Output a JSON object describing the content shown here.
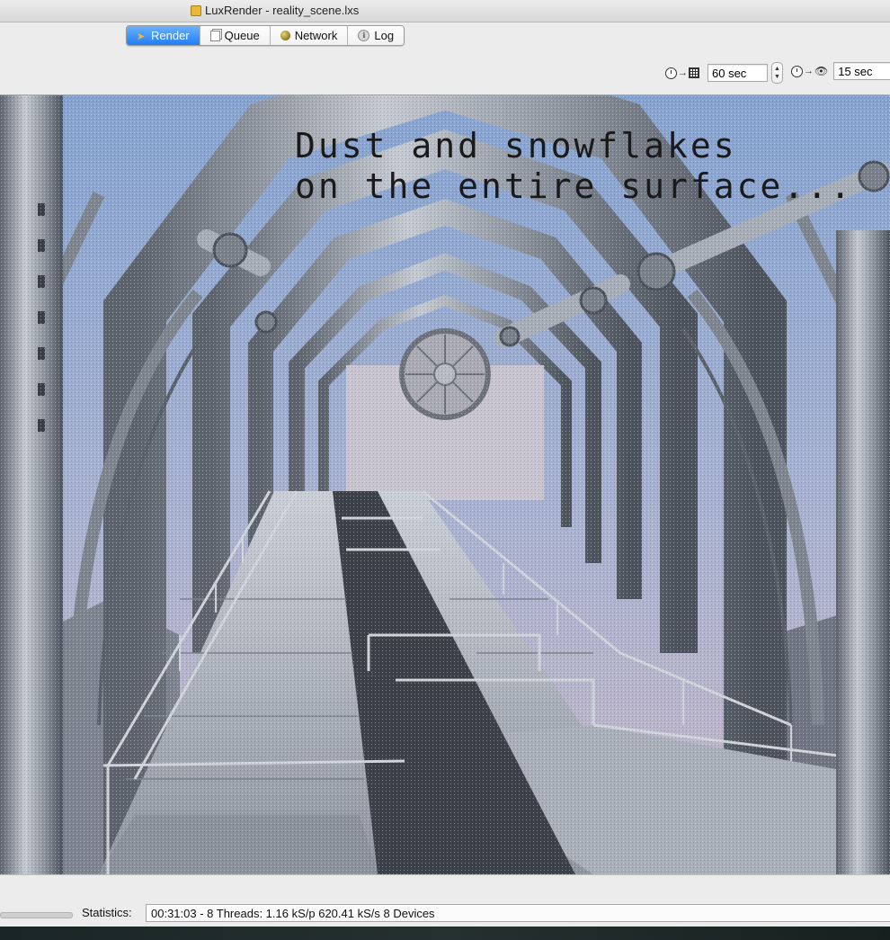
{
  "window": {
    "title": "LuxRender - reality_scene.lxs"
  },
  "tabs": [
    {
      "label": "Render",
      "icon": "render-arrow-icon",
      "active": true
    },
    {
      "label": "Queue",
      "icon": "queue-icon",
      "active": false
    },
    {
      "label": "Network",
      "icon": "network-globe-icon",
      "active": false
    },
    {
      "label": "Log",
      "icon": "log-info-icon",
      "active": false
    }
  ],
  "timers": {
    "halt_time_value": "60 sec",
    "refresh_time_value": "15 sec"
  },
  "render": {
    "overlay_line1": "Dust and snowflakes",
    "overlay_line2": "on the entire surface..."
  },
  "status": {
    "statistics_label": "Statistics:",
    "statistics_value": "00:31:03 - 8 Threads: 1.16 kS/p 620.41 kS/s 8 Devices"
  },
  "colors": {
    "active_tab": "#1f7ef6",
    "sky": "#8ea6c9",
    "metal": "#9aa1ab"
  }
}
